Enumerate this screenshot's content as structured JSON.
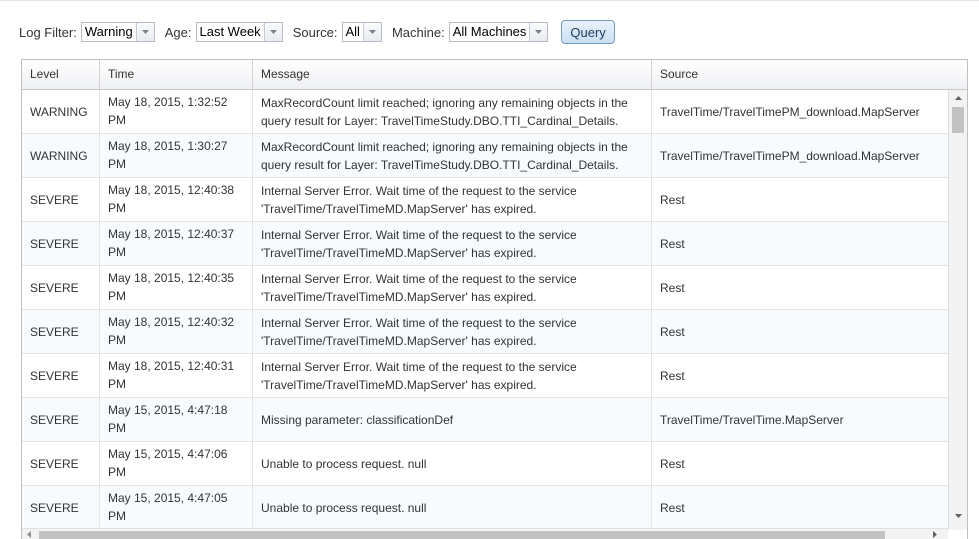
{
  "filters": {
    "log_filter": {
      "label": "Log Filter:",
      "value": "Warning"
    },
    "age": {
      "label": "Age:",
      "value": "Last Week"
    },
    "source": {
      "label": "Source:",
      "value": "All"
    },
    "machine": {
      "label": "Machine:",
      "value": "All Machines"
    },
    "query_label": "Query"
  },
  "grid": {
    "columns": [
      "Level",
      "Time",
      "Message",
      "Source"
    ],
    "rows": [
      {
        "level": "WARNING",
        "time": "May 18, 2015, 1:32:52 PM",
        "message": "MaxRecordCount limit reached; ignoring any remaining objects in the query result for Layer: TravelTimeStudy.DBO.TTI_Cardinal_Details.",
        "source": "TravelTime/TravelTimePM_download.MapServer"
      },
      {
        "level": "WARNING",
        "time": "May 18, 2015, 1:30:27 PM",
        "message": "MaxRecordCount limit reached; ignoring any remaining objects in the query result for Layer: TravelTimeStudy.DBO.TTI_Cardinal_Details.",
        "source": "TravelTime/TravelTimePM_download.MapServer"
      },
      {
        "level": "SEVERE",
        "time": "May 18, 2015, 12:40:38 PM",
        "message": "Internal Server Error. Wait time of the request to the service 'TravelTime/TravelTimeMD.MapServer' has expired.",
        "source": "Rest"
      },
      {
        "level": "SEVERE",
        "time": "May 18, 2015, 12:40:37 PM",
        "message": "Internal Server Error. Wait time of the request to the service 'TravelTime/TravelTimeMD.MapServer' has expired.",
        "source": "Rest"
      },
      {
        "level": "SEVERE",
        "time": "May 18, 2015, 12:40:35 PM",
        "message": "Internal Server Error. Wait time of the request to the service 'TravelTime/TravelTimeMD.MapServer' has expired.",
        "source": "Rest"
      },
      {
        "level": "SEVERE",
        "time": "May 18, 2015, 12:40:32 PM",
        "message": "Internal Server Error. Wait time of the request to the service 'TravelTime/TravelTimeMD.MapServer' has expired.",
        "source": "Rest"
      },
      {
        "level": "SEVERE",
        "time": "May 18, 2015, 12:40:31 PM",
        "message": "Internal Server Error. Wait time of the request to the service 'TravelTime/TravelTimeMD.MapServer' has expired.",
        "source": "Rest"
      },
      {
        "level": "SEVERE",
        "time": "May 15, 2015, 4:47:18 PM",
        "message": "Missing parameter: classificationDef",
        "source": "TravelTime/TravelTime.MapServer"
      },
      {
        "level": "SEVERE",
        "time": "May 15, 2015, 4:47:06 PM",
        "message": "Unable to process request. null",
        "source": "Rest"
      },
      {
        "level": "SEVERE",
        "time": "May 15, 2015, 4:47:05 PM",
        "message": "Unable to process request. null",
        "source": "Rest"
      }
    ]
  },
  "icons": {
    "dropdown": "chevron-down-icon",
    "scroll_up": "arrow-up-icon",
    "scroll_down": "arrow-down-icon",
    "scroll_left": "arrow-left-icon",
    "scroll_right": "arrow-right-icon"
  }
}
